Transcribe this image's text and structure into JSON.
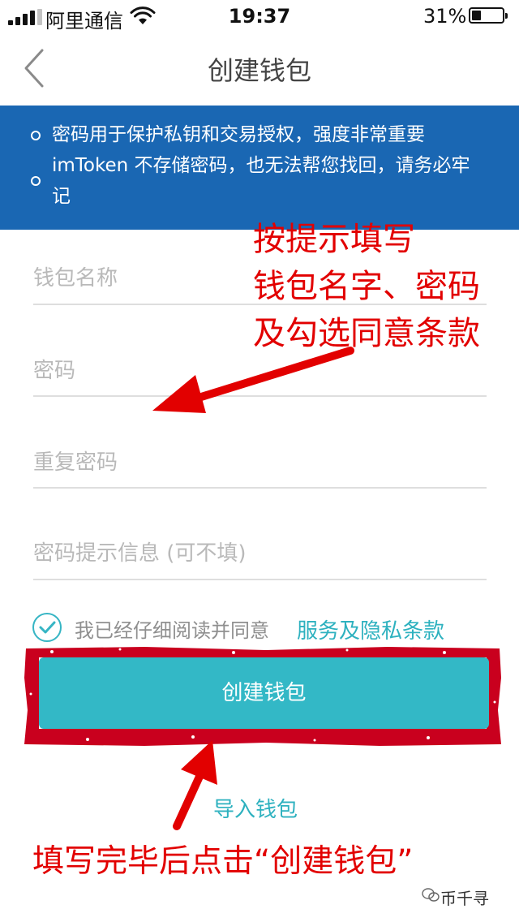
{
  "status_bar": {
    "carrier": "阿里通信",
    "time": "19:37",
    "battery_percent": "31%",
    "battery_level": 0.31
  },
  "nav": {
    "title": "创建钱包",
    "back_icon": "chevron-left-icon"
  },
  "banner": {
    "items": [
      "密码用于保护私钥和交易授权，强度非常重要",
      "imToken 不存储密码，也无法帮您找回，请务必牢",
      "记"
    ]
  },
  "form": {
    "wallet_name_placeholder": "钱包名称",
    "password_placeholder": "密码",
    "repeat_password_placeholder": "重复密码",
    "hint_placeholder": "密码提示信息 (可不填)"
  },
  "agreement": {
    "checked": true,
    "text": "我已经仔细阅读并同意",
    "link": "服务及隐私条款"
  },
  "buttons": {
    "create": "创建钱包",
    "import": "导入钱包"
  },
  "annotations": {
    "top_lines": [
      "按提示填写",
      "钱包名字、密码",
      "及勾选同意条款"
    ],
    "bottom": "填写完毕后点击“创建钱包”"
  },
  "watermark": "币千寻",
  "colors": {
    "banner": "#1a67b3",
    "accent": "#33b8c6",
    "annotation": "#e20000"
  }
}
